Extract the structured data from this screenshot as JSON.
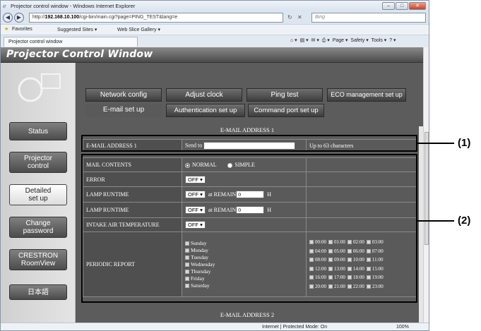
{
  "window": {
    "title": "Projector control window - Windows Internet Explorer"
  },
  "address": {
    "url_prefix": "http://",
    "url_host": "192.168.10.100",
    "url_path": "/cgi-bin/main.cgi?page=PING_TEST&lang=e",
    "search_placeholder": "Bing"
  },
  "favorites": {
    "favorites_label": "Favorites",
    "suggested": "Suggested Sites ▾",
    "webslice": "Web Slice Gallery ▾"
  },
  "tab": {
    "label": "Projector control window"
  },
  "commands": {
    "page": "Page ▾",
    "safety": "Safety ▾",
    "tools": "Tools ▾"
  },
  "page_header": {
    "title": "Projector Control Window"
  },
  "top_nav": [
    "Network config",
    "Adjust clock",
    "Ping test",
    "ECO management set up"
  ],
  "sub_nav": {
    "selected": "E-mail set up",
    "items": [
      "Authentication set up",
      "Command port set up"
    ]
  },
  "sidebar": [
    "Status",
    "Projector\ncontrol",
    "Detailed\nset up",
    "Change\npassword",
    "CRESTRON\nRoomView",
    "日本語"
  ],
  "email1": {
    "header": "E-MAIL ADDRESS 1",
    "row_label": "E-MAIL ADDRESS 1",
    "send_to": "Send to",
    "limit": "Up to 63 characters"
  },
  "settings": {
    "mail_contents": {
      "label": "MAIL CONTENTS",
      "normal": "NORMAL",
      "simple": "SIMPLE"
    },
    "error": {
      "label": "ERROR",
      "value": "OFF"
    },
    "lamp1": {
      "label": "LAMP RUNTIME",
      "value": "OFF",
      "remain": "at REMAIN",
      "remain_value": "0",
      "unit": "H"
    },
    "lamp2": {
      "label": "LAMP RUNTIME",
      "value": "OFF",
      "remain": "at REMAIN",
      "remain_value": "0",
      "unit": "H"
    },
    "intake": {
      "label": "INTAKE AIR TEMPERATURE",
      "value": "OFF"
    },
    "periodic": {
      "label": "PERIODIC REPORT",
      "days": [
        "Sunday",
        "Monday",
        "Tuesday",
        "Wednesday",
        "Thursday",
        "Friday",
        "Saturday"
      ],
      "times": [
        "00:00",
        "01:00",
        "02:00",
        "03:00",
        "04:00",
        "05:00",
        "06:00",
        "07:00",
        "08:00",
        "09:00",
        "10:00",
        "11:00",
        "12:00",
        "13:00",
        "14:00",
        "15:00",
        "16:00",
        "17:00",
        "18:00",
        "19:00",
        "20:00",
        "21:00",
        "22:00",
        "23:00"
      ]
    }
  },
  "email2": {
    "header": "E-MAIL ADDRESS 2"
  },
  "callouts": [
    "(1)",
    "(2)"
  ],
  "status": {
    "zone": "Internet | Protected Mode: On",
    "zoom": "100%"
  }
}
